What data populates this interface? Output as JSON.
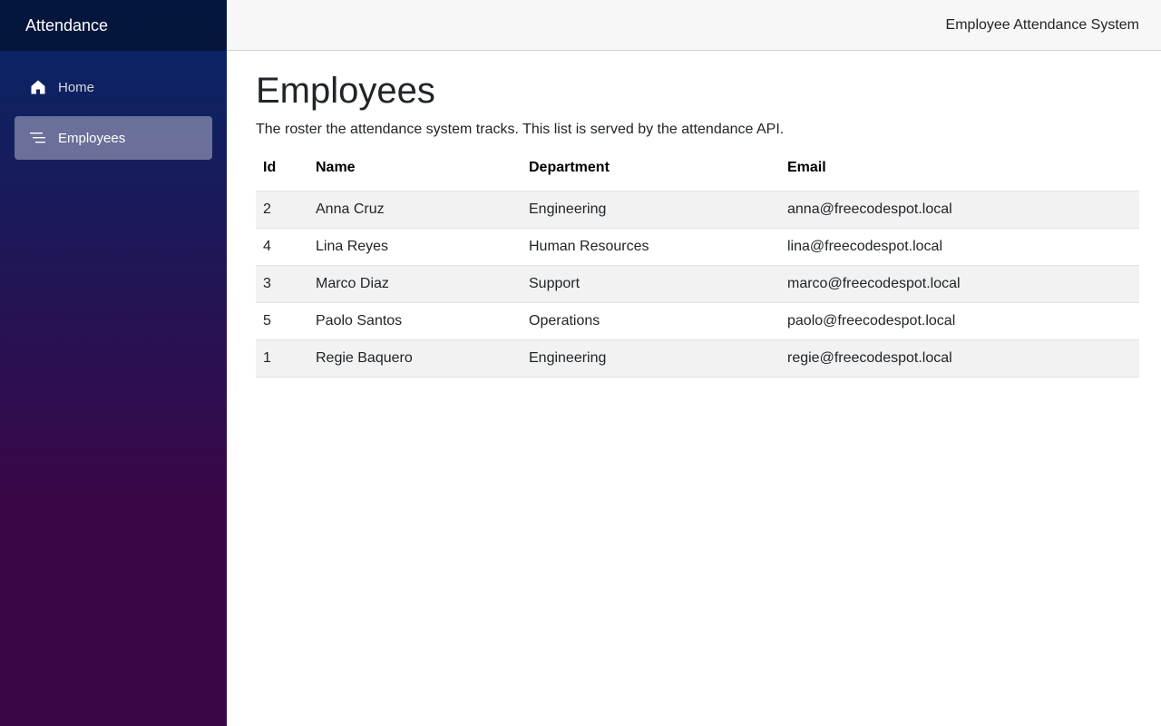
{
  "sidebar": {
    "brand": "Attendance",
    "items": [
      {
        "label": "Home",
        "icon": "home-icon",
        "active": false
      },
      {
        "label": "Employees",
        "icon": "list-icon",
        "active": true
      }
    ]
  },
  "header": {
    "link": "Employee Attendance System"
  },
  "main": {
    "title": "Employees",
    "description": "The roster the attendance system tracks. This list is served by the attendance API.",
    "table": {
      "headers": [
        "Id",
        "Name",
        "Department",
        "Email"
      ],
      "rows": [
        [
          "2",
          "Anna Cruz",
          "Engineering",
          "anna@freecodespot.local"
        ],
        [
          "4",
          "Lina Reyes",
          "Human Resources",
          "lina@freecodespot.local"
        ],
        [
          "3",
          "Marco Diaz",
          "Support",
          "marco@freecodespot.local"
        ],
        [
          "5",
          "Paolo Santos",
          "Operations",
          "paolo@freecodespot.local"
        ],
        [
          "1",
          "Regie Baquero",
          "Engineering",
          "regie@freecodespot.local"
        ]
      ]
    }
  },
  "colors": {
    "sidebar_gradient_top": "#052767",
    "sidebar_gradient_bottom": "#3a0647",
    "active_item_bg": "#6b6e9e",
    "top_row_bg": "#f7f7f7",
    "stripe_bg": "#f2f2f2"
  }
}
